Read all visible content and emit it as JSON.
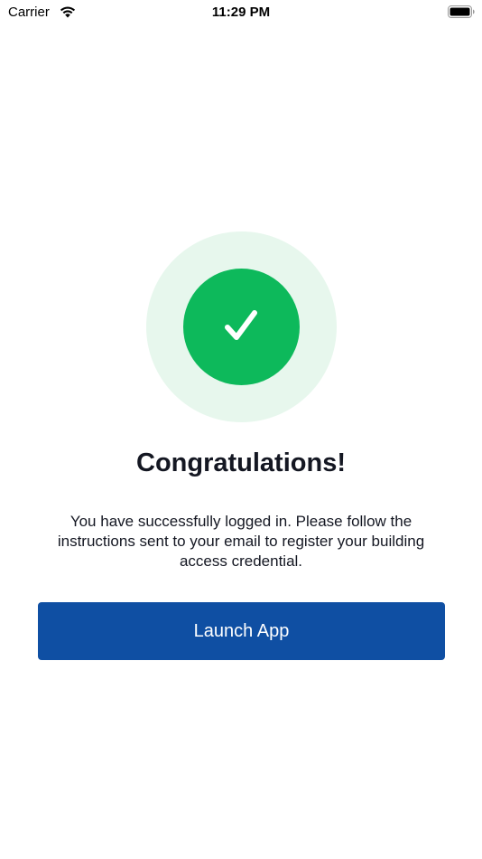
{
  "status_bar": {
    "carrier": "Carrier",
    "time": "11:29 PM",
    "wifi_icon": "wifi-icon",
    "battery_icon": "battery-icon"
  },
  "success": {
    "icon": "check-icon",
    "halo_color": "#e7f7ed",
    "circle_color": "#0db95b"
  },
  "title": "Congratulations!",
  "message": "You have successfully logged in. Please follow the instructions sent to your email to register your building access credential.",
  "launch_button": {
    "label": "Launch App",
    "color": "#0f4fa3"
  }
}
